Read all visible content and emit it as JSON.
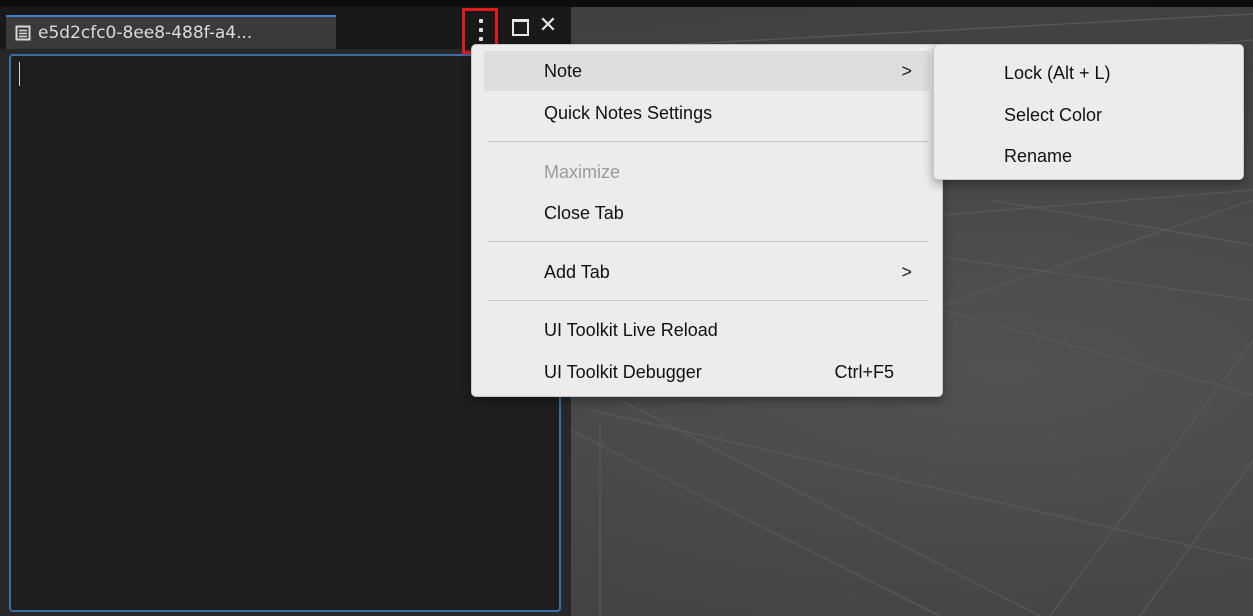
{
  "tab": {
    "title": "e5d2cfc0-8ee8-488f-a4...",
    "icon": "document-icon"
  },
  "window_controls": {
    "menu_icon": "kebab-menu-icon",
    "maximize_icon": "maximize-icon",
    "close_icon": "close-icon",
    "close_glyph": "✕",
    "highlight_color": "#e01b1b"
  },
  "editor": {
    "text": ""
  },
  "context_menu": {
    "items": [
      {
        "label": "Note",
        "submenu": true,
        "arrow": ">"
      },
      {
        "label": "Quick Notes Settings"
      },
      {
        "label": "Maximize",
        "disabled": true
      },
      {
        "label": "Close Tab"
      },
      {
        "label": "Add Tab",
        "submenu": true,
        "arrow": ">"
      },
      {
        "label": "UI Toolkit Live Reload"
      },
      {
        "label": "UI Toolkit Debugger",
        "shortcut": "Ctrl+F5"
      }
    ]
  },
  "note_submenu": {
    "items": [
      {
        "label": "Lock (Alt + L)"
      },
      {
        "label": "Select Color"
      },
      {
        "label": "Rename"
      }
    ]
  },
  "colors": {
    "accent_border": "#3b6ea5",
    "tab_accent": "#3b82c4",
    "menu_bg": "#ececec"
  }
}
